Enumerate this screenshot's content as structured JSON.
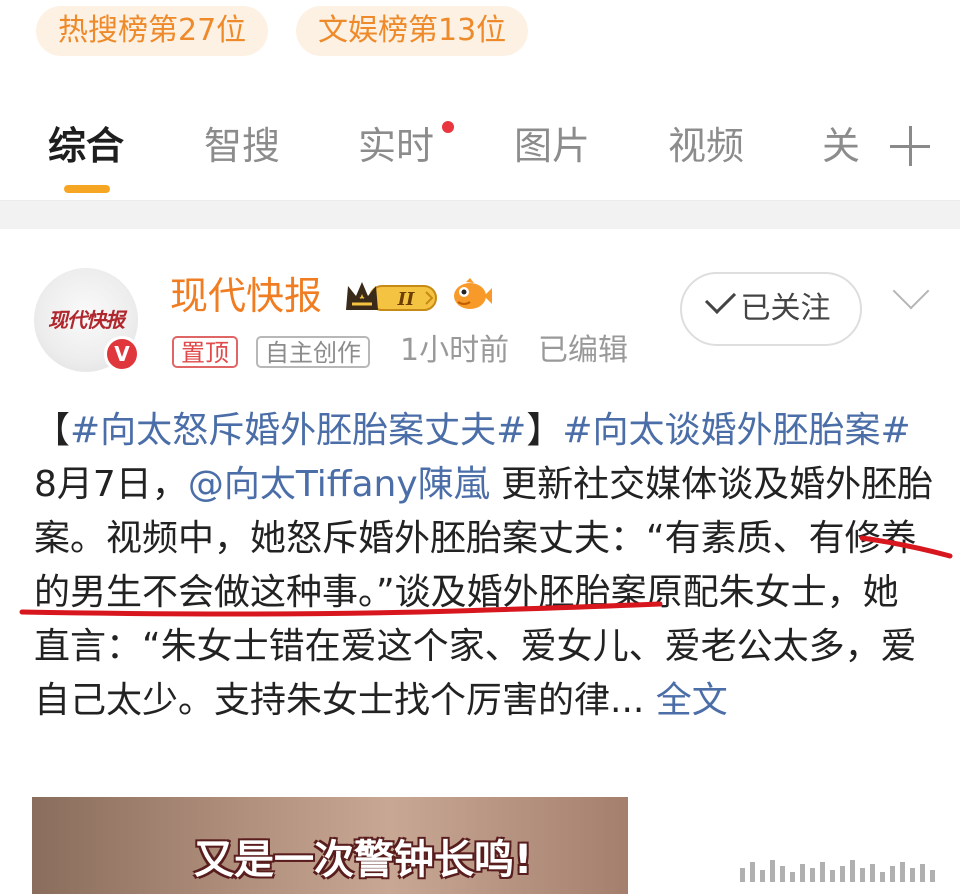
{
  "hot_chips": [
    "热搜榜第27位",
    "文娱榜第13位"
  ],
  "tabs": [
    {
      "label": "综合",
      "active": true
    },
    {
      "label": "智搜"
    },
    {
      "label": "实时",
      "dot": true
    },
    {
      "label": "图片"
    },
    {
      "label": "视频"
    },
    {
      "label": "关"
    }
  ],
  "post": {
    "author": "现代快报",
    "avatar_text": "现代快报",
    "verified_label": "V",
    "tags": [
      "置顶",
      "自主创作"
    ],
    "time": "1小时前",
    "edited": "已编辑",
    "follow_label": "已关注",
    "text": {
      "p1": "【",
      "hashtag1": "#向太怒斥婚外胚胎案丈夫#",
      "p2": "】",
      "hashtag2": "#向太谈婚外胚胎案#",
      "p3": " 8月7日，",
      "mention": "@向太Tiffany陳嵐",
      "p4": " 更新社交媒体谈及婚外胚胎案。视频中，她怒斥婚外胚胎案丈夫：“有素质、有修养的男生不会做这种事。”谈及婚外胚胎案原配朱女士，她直言：“朱女士错在爱这个家、爱女儿、爱老公太多，爱自己太少。支持朱女士找个厉害的律...",
      "full_text": "全文"
    },
    "image_caption": "又是一次警钟长鸣!"
  },
  "colors": {
    "accent_orange": "#f07d22",
    "chip_bg": "#fdf1e4",
    "tab_underline": "#f7a623",
    "link_blue": "#4b6ea8",
    "pen_red": "#d8161e"
  },
  "icons": [
    "plus-icon",
    "chevron-down-icon",
    "crown-badge",
    "fish-icon",
    "check-icon",
    "verified-badge"
  ]
}
